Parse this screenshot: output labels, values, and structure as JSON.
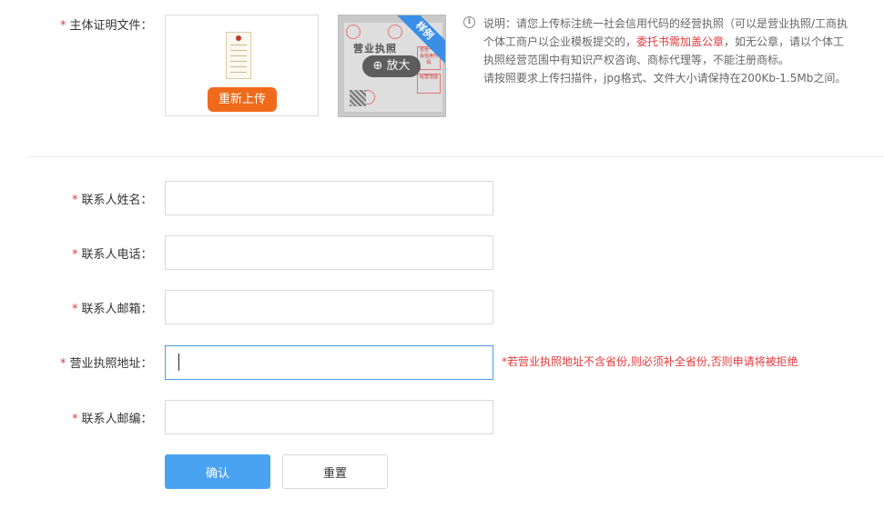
{
  "form": {
    "required_mark": "*",
    "subject_doc_label": "主体证明文件：",
    "reupload_label": "重新上传",
    "sample": {
      "ribbon": "样例",
      "title": "营业执照",
      "zoom_label": "放大",
      "note_1": "包含一社会信用代码",
      "note_2": "经营范围"
    },
    "info": {
      "line1": "说明：请您上传标注统一社会信用代码的经营执照（可以是营业执照/工商执",
      "line2_a": "个体工商户以企业模板提交的，",
      "line2_hl": "委托书需加盖公章",
      "line2_b": "，如无公章，请以个体工",
      "line3": "执照经营范围中有知识产权咨询、商标代理等，不能注册商标。",
      "line4": "请按照要求上传扫描件，jpg格式、文件大小请保持在200Kb-1.5Mb之间。"
    },
    "contact_name_label": "联系人姓名：",
    "contact_phone_label": "联系人电话：",
    "contact_email_label": "联系人邮箱：",
    "license_address_label": "营业执照地址：",
    "contact_zip_label": "联系人邮编：",
    "address_warning": "*若营业执照地址不含省份,则必须补全省份,否则申请将被拒绝",
    "confirm_label": "确认",
    "reset_label": "重置",
    "contact_name_value": "",
    "contact_phone_value": "",
    "contact_email_value": "",
    "license_address_value": "",
    "contact_zip_value": ""
  },
  "colors": {
    "required": "#e4393c",
    "upload_button": "#ef6a1b",
    "confirm_button": "#4aa3f0",
    "focus_border": "#4a9be8"
  },
  "icons": {
    "info": "info-circle-icon",
    "zoom": "zoom-in-icon"
  }
}
